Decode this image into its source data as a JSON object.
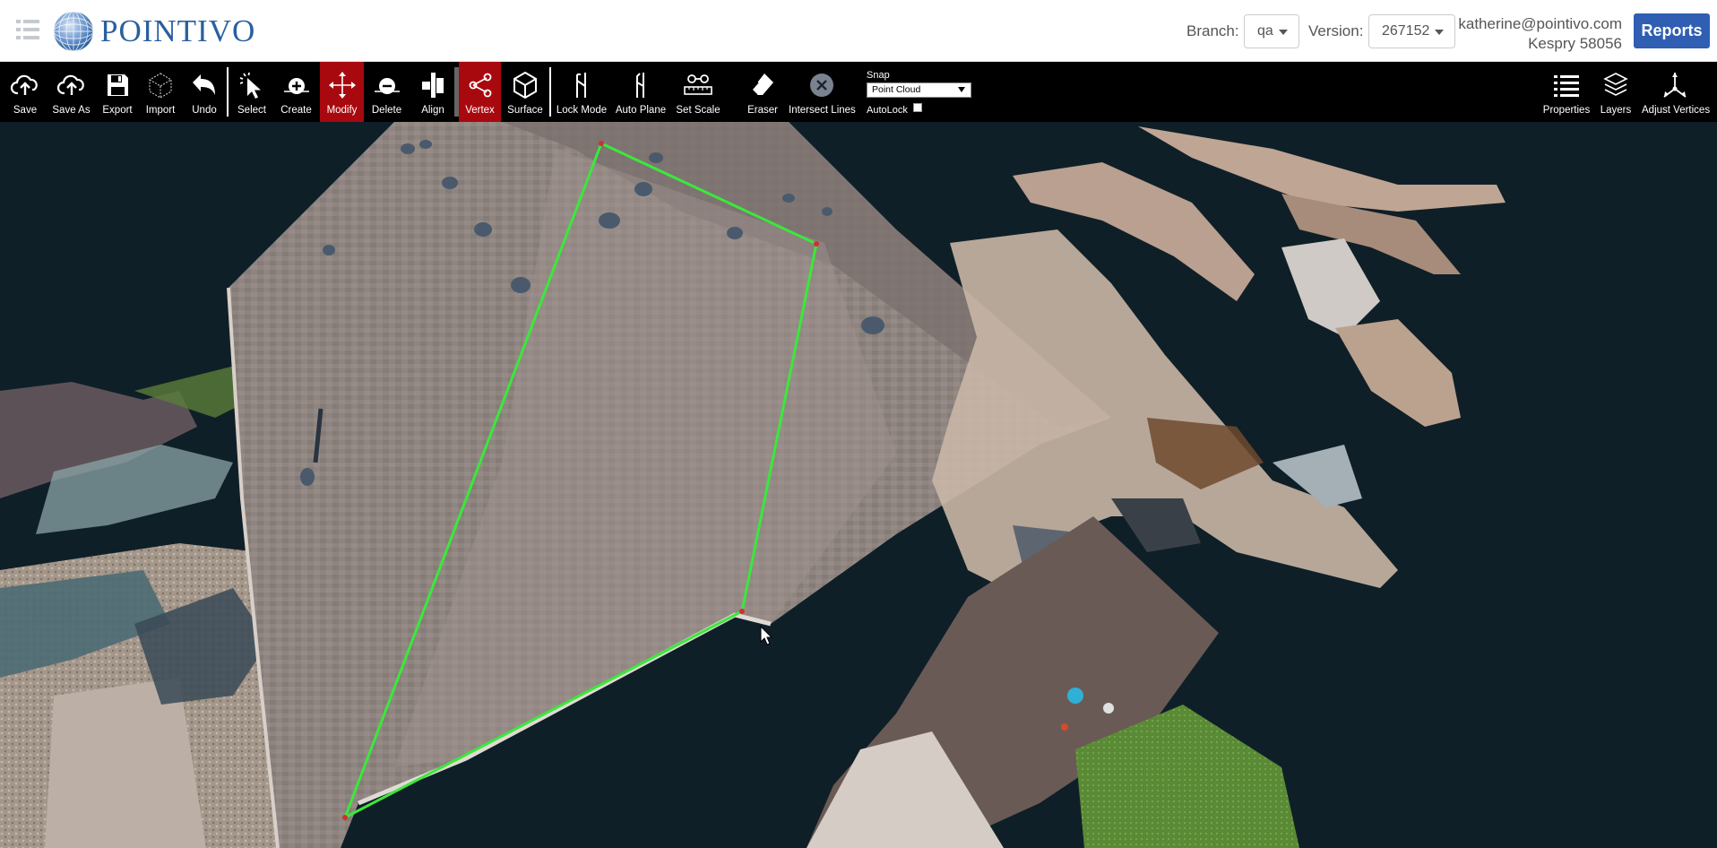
{
  "header": {
    "logo_text": "POINTIVO",
    "branch_label": "Branch:",
    "branch_value": "qa",
    "version_label": "Version:",
    "version_value": "267152",
    "user_email": "katherine@pointivo.com",
    "project_name": "Kespry 58056",
    "reports_label": "Reports",
    "brand_color": "#2f5eb3"
  },
  "toolbar": {
    "tools": [
      {
        "label": "Save",
        "icon": "cloud-upload-icon"
      },
      {
        "label": "Save As",
        "icon": "cloud-upload-icon"
      },
      {
        "label": "Export",
        "icon": "floppy-disk-icon"
      },
      {
        "label": "Import",
        "icon": "wireframe-cube-icon"
      },
      {
        "label": "Undo",
        "icon": "undo-arrow-icon"
      },
      {
        "label": "Select",
        "icon": "cursor-click-icon"
      },
      {
        "label": "Create",
        "icon": "plus-circle-icon"
      },
      {
        "label": "Modify",
        "icon": "move-arrows-icon",
        "active": true
      },
      {
        "label": "Delete",
        "icon": "minus-circle-icon"
      },
      {
        "label": "Align",
        "icon": "align-icon"
      },
      {
        "label": "Vertex",
        "icon": "share-nodes-icon",
        "active": true
      },
      {
        "label": "Surface",
        "icon": "cube-icon"
      },
      {
        "label": "Lock Mode",
        "icon": "lock-mode-icon"
      },
      {
        "label": "Auto Plane",
        "icon": "auto-plane-icon"
      },
      {
        "label": "Set Scale",
        "icon": "ruler-icon"
      },
      {
        "label": "Eraser",
        "icon": "eraser-icon"
      },
      {
        "label": "Intersect Lines",
        "icon": "close-circle-icon"
      }
    ],
    "right_tools": [
      {
        "label": "Properties",
        "icon": "list-icon"
      },
      {
        "label": "Layers",
        "icon": "layers-icon"
      },
      {
        "label": "Adjust Vertices",
        "icon": "adjust-vertices-icon"
      }
    ],
    "active_color": "#a8090e",
    "snap_title": "Snap",
    "snap_value": "Point Cloud",
    "autolock_label": "AutoLock",
    "autolock_checked": false
  },
  "viewport": {
    "selection_color": "#3be83b",
    "background_color": "#0f1f27"
  }
}
